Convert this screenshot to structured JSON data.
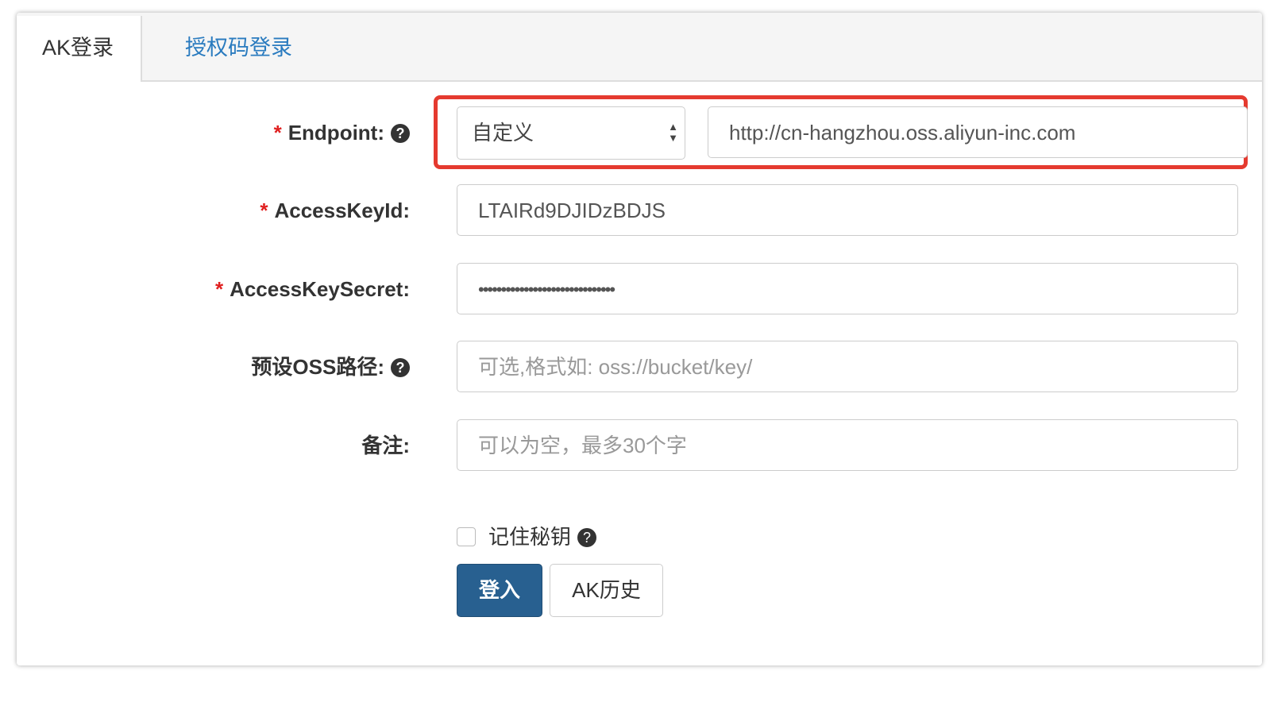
{
  "tabs": [
    {
      "label": "AK登录",
      "active": true
    },
    {
      "label": "授权码登录",
      "active": false
    }
  ],
  "form": {
    "required_mark": "*",
    "help_glyph": "?",
    "endpoint": {
      "label": "Endpoint:",
      "select_value": "自定义",
      "url_value": "http://cn-hangzhou.oss.aliyun-inc.com"
    },
    "access_key_id": {
      "label": "AccessKeyId:",
      "value": "LTAIRd9DJIDzBDJS"
    },
    "access_key_secret": {
      "label": "AccessKeySecret:",
      "value": "••••••••••••••••••••••••••••••"
    },
    "oss_path": {
      "label": "预设OSS路径:",
      "placeholder": "可选,格式如: oss://bucket/key/"
    },
    "note": {
      "label": "备注:",
      "placeholder": "可以为空，最多30个字"
    },
    "remember": {
      "label": "记住秘钥",
      "checked": false
    },
    "login_button": "登入",
    "history_button": "AK历史"
  },
  "colors": {
    "accent": "#286090",
    "highlight": "#e53a2f",
    "tab_link": "#2a7bbf"
  }
}
